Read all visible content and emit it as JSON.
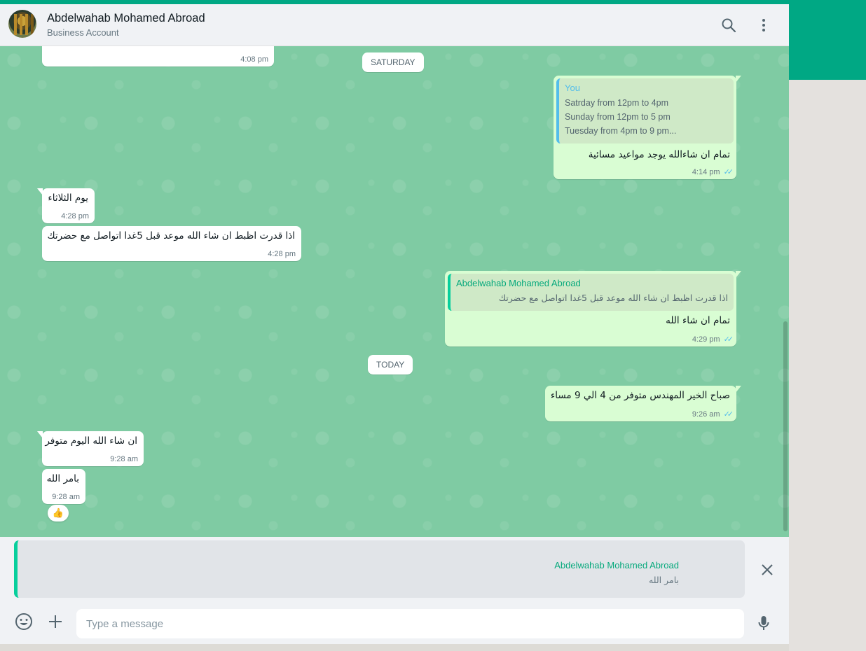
{
  "header": {
    "contact_name": "Abdelwahab Mohamed Abroad",
    "contact_subtitle": "Business Account",
    "avatar_icon": "avatar-photo",
    "search_icon": "search-icon",
    "menu_icon": "kebab-menu-icon"
  },
  "chat": {
    "date_saturday": "SATURDAY",
    "date_today": "TODAY",
    "messages": [
      {
        "dir": "in",
        "text": "",
        "time": "4:08 pm"
      },
      {
        "dir": "out",
        "quote_author": "You",
        "quote_lines": [
          "Satrday from 12pm to 4pm",
          "Sunday from 12pm to 5 pm",
          "Tuesday from 4pm to 9 pm..."
        ],
        "text": "تمام ان شاءالله يوجد مواعيد مسائية",
        "time": "4:14 pm"
      },
      {
        "dir": "in",
        "text": "يوم الثلاثاء",
        "time": "4:28 pm"
      },
      {
        "dir": "in",
        "text": "اذا قدرت اظبط ان شاء الله موعد قبل 5غدا اتواصل مع حضرتك",
        "time": "4:28 pm"
      },
      {
        "dir": "out",
        "quote_author": "Abdelwahab Mohamed Abroad",
        "quote_lines": [
          "اذا قدرت اظبط ان شاء الله موعد قبل 5غدا اتواصل مع حضرتك"
        ],
        "text": "تمام ان شاء الله",
        "time": "4:29 pm"
      },
      {
        "dir": "out",
        "text": "صباح الخير المهندس متوفر من 4 الي 9 مساء",
        "time": "9:26 am"
      },
      {
        "dir": "in",
        "text": "ان شاء الله اليوم متوفر",
        "time": "9:28 am"
      },
      {
        "dir": "in",
        "text": "بامر الله",
        "time": "9:28 am",
        "reaction": "👍"
      }
    ]
  },
  "reply_preview": {
    "author": "Abdelwahab Mohamed Abroad",
    "text": "بامر الله"
  },
  "composer": {
    "placeholder": "Type a message"
  },
  "colors": {
    "brand": "#00a884",
    "chat_bg": "#7fcba3",
    "outgoing_bubble": "#d9fdd3",
    "incoming_bubble": "#ffffff",
    "read_ticks": "#53bdeb"
  }
}
